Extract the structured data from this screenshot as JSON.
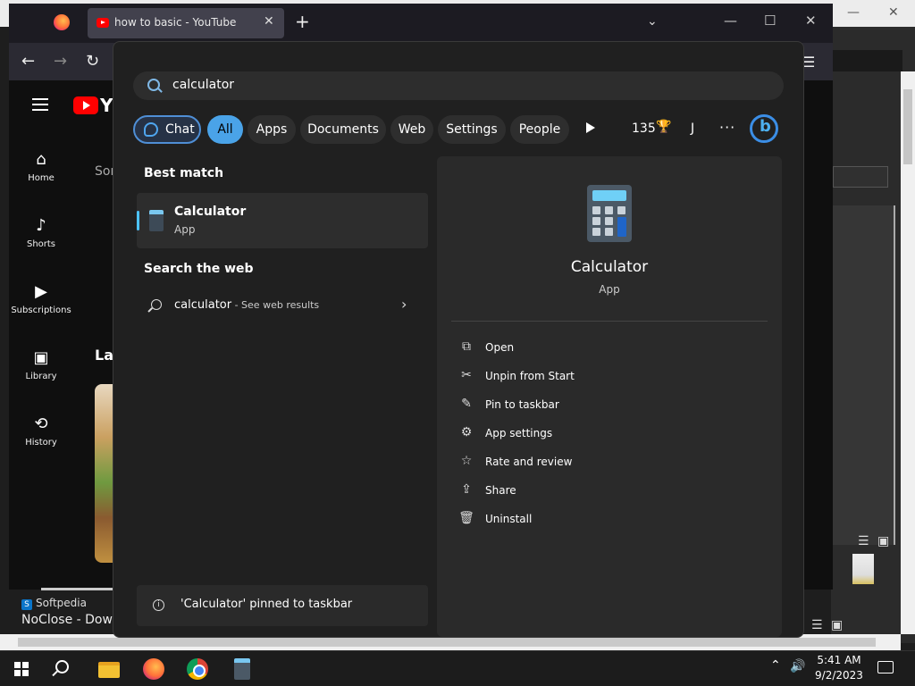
{
  "browser": {
    "tab_title": "how to basic - YouTube",
    "tab_close": "✕",
    "new_tab": "+",
    "tab_list": "⌄",
    "window_minimize": "—",
    "window_maximize": "☐",
    "window_close": "✕",
    "nav_back": "←",
    "nav_forward": "→",
    "nav_reload": "↻",
    "menu": "☰"
  },
  "youtube": {
    "logo_text": "Y",
    "nav": [
      {
        "label": "Home",
        "icon": "⌂"
      },
      {
        "label": "Shorts",
        "icon": "♪"
      },
      {
        "label": "Subscriptions",
        "icon": "▶"
      },
      {
        "label": "Library",
        "icon": "▣"
      },
      {
        "label": "History",
        "icon": "⟲"
      }
    ],
    "peek_text_1": "Sor",
    "peek_text_2": "Lat"
  },
  "watermark": {
    "softpedia_icon": "S",
    "softpedia": "Softpedia",
    "noclose": "NoClose - Down"
  },
  "search": {
    "query": "calculator",
    "filters": {
      "chat": "Chat",
      "all": "All",
      "apps": "Apps",
      "documents": "Documents",
      "web": "Web",
      "settings": "Settings",
      "people": "People"
    },
    "rewards_points": "135",
    "rewards_icon": "🏆",
    "profile_initial": "J",
    "more": "···",
    "best_match_heading": "Best match",
    "best_match": {
      "title": "Calculator",
      "subtitle": "App"
    },
    "search_web_heading": "Search the web",
    "web_result": {
      "query": "calculator",
      "hint": " - See web results"
    },
    "chevron": "›",
    "toast": {
      "icon": "i",
      "text": "'Calculator' pinned to taskbar"
    },
    "detail": {
      "title": "Calculator",
      "subtitle": "App",
      "actions": [
        {
          "label": "Open",
          "icon": "⧉"
        },
        {
          "label": "Unpin from Start",
          "icon": "✂"
        },
        {
          "label": "Pin to taskbar",
          "icon": "✎"
        },
        {
          "label": "App settings",
          "icon": "⚙"
        },
        {
          "label": "Rate and review",
          "icon": "☆"
        },
        {
          "label": "Share",
          "icon": "⇪"
        },
        {
          "label": "Uninstall",
          "icon": "🗑"
        }
      ]
    }
  },
  "taskbar": {
    "tray_chevron": "⌃",
    "volume": "🔊",
    "time": "5:41 AM",
    "date": "9/2/2023"
  },
  "colors": {
    "accent": "#4aa3e8",
    "panel_bg": "#202020",
    "youtube_red": "#ff0000"
  }
}
